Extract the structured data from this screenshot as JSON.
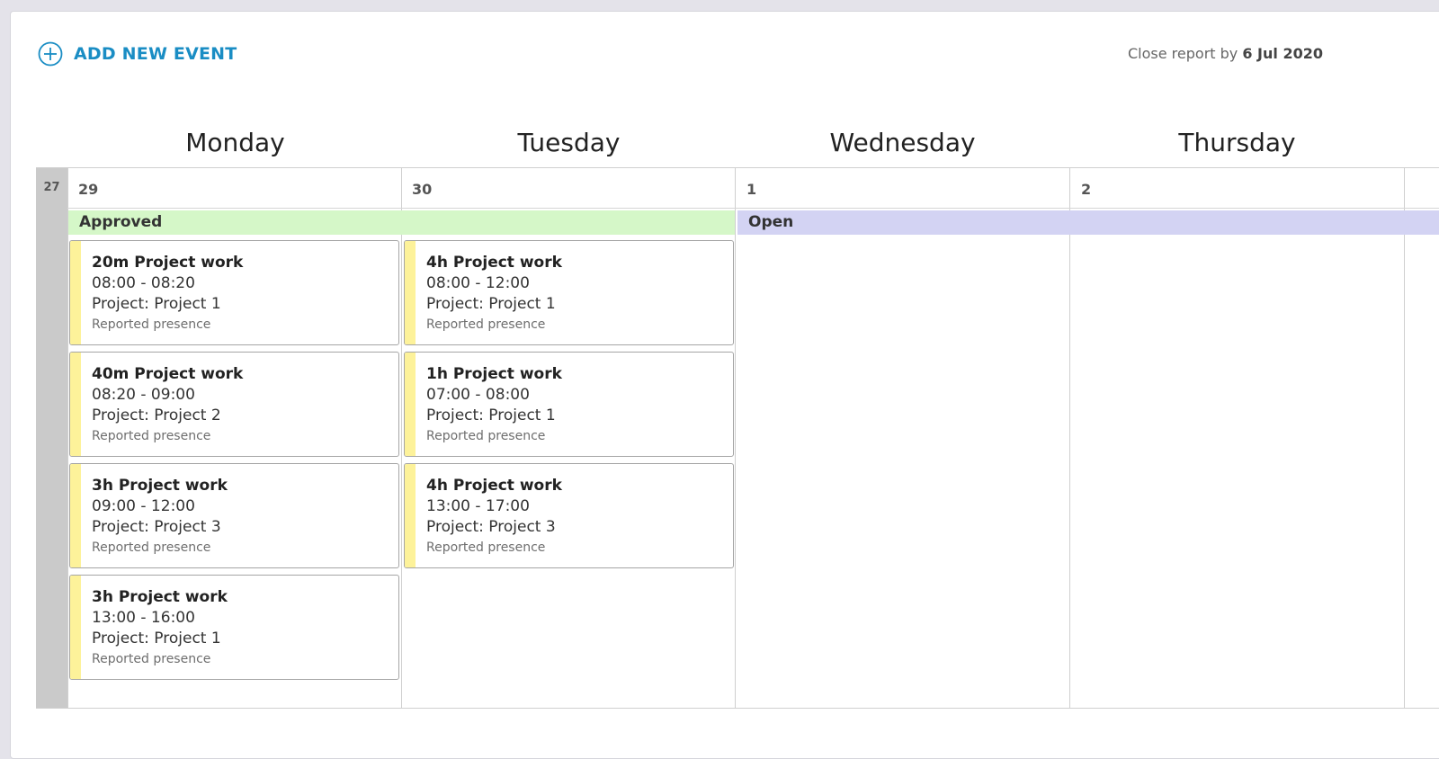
{
  "toolbar": {
    "add_event_label": "ADD NEW EVENT",
    "close_report_prefix": "Close report by",
    "close_report_date": "6 Jul 2020"
  },
  "week": {
    "number": "27",
    "days": [
      {
        "name": "Monday",
        "date": "29"
      },
      {
        "name": "Tuesday",
        "date": "30"
      },
      {
        "name": "Wednesday",
        "date": "1"
      },
      {
        "name": "Thursday",
        "date": "2"
      }
    ]
  },
  "status": {
    "approved": "Approved",
    "open": "Open"
  },
  "colors": {
    "accent": "#1a8dc4",
    "approved_bg": "#d5f7c8",
    "open_bg": "#d3d3f3",
    "event_stripe": "#fdf29a",
    "week_column": "#cacaca"
  },
  "events": {
    "monday": [
      {
        "title": "20m Project work",
        "time": "08:00 - 08:20",
        "project": "Project: Project 1",
        "note": "Reported presence"
      },
      {
        "title": "40m Project work",
        "time": "08:20 - 09:00",
        "project": "Project: Project 2",
        "note": "Reported presence"
      },
      {
        "title": "3h Project work",
        "time": "09:00 - 12:00",
        "project": "Project: Project 3",
        "note": "Reported presence"
      },
      {
        "title": "3h Project work",
        "time": "13:00 - 16:00",
        "project": "Project: Project 1",
        "note": "Reported presence"
      }
    ],
    "tuesday": [
      {
        "title": "4h Project work",
        "time": "08:00 - 12:00",
        "project": "Project: Project 1",
        "note": "Reported presence"
      },
      {
        "title": "1h Project work",
        "time": "07:00 - 08:00",
        "project": "Project: Project 1",
        "note": "Reported presence"
      },
      {
        "title": "4h Project work",
        "time": "13:00 - 17:00",
        "project": "Project: Project 3",
        "note": "Reported presence"
      }
    ]
  }
}
